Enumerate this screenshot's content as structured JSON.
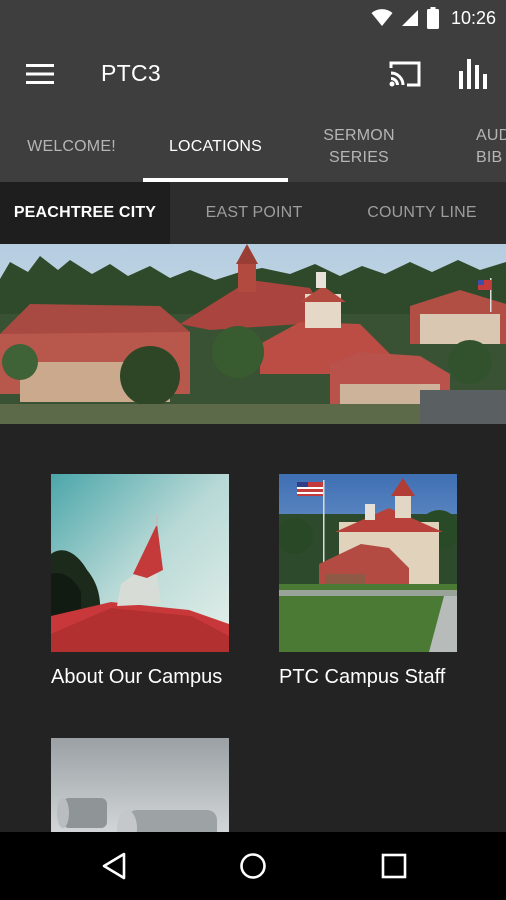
{
  "status_bar": {
    "time": "10:26",
    "icons": [
      "wifi-icon",
      "signal-icon",
      "battery-icon"
    ]
  },
  "app_bar": {
    "title": "PTC3",
    "icons": [
      "menu-icon",
      "cast-icon",
      "stats-icon"
    ]
  },
  "main_tabs": [
    {
      "label": "WELCOME!",
      "active": false
    },
    {
      "label": "LOCATIONS",
      "active": true
    },
    {
      "label": "SERMON\nSERIES",
      "active": false
    },
    {
      "label": "AUD\nBIB",
      "active": false
    }
  ],
  "sub_tabs": [
    {
      "label": "PEACHTREE CITY",
      "active": true
    },
    {
      "label": "EAST POINT",
      "active": false
    },
    {
      "label": "COUNTY LINE",
      "active": false
    }
  ],
  "cards": [
    {
      "label": "About Our Campus"
    },
    {
      "label": "PTC Campus Staff"
    },
    {
      "label": ""
    }
  ],
  "nav_bar": {
    "icons": [
      "back-icon",
      "home-icon",
      "recents-icon"
    ]
  },
  "colors": {
    "app_bar": "#3e3e3e",
    "sub_tabs": "#2d2d2d",
    "background": "#232323",
    "roof_red": "#b8494a"
  }
}
